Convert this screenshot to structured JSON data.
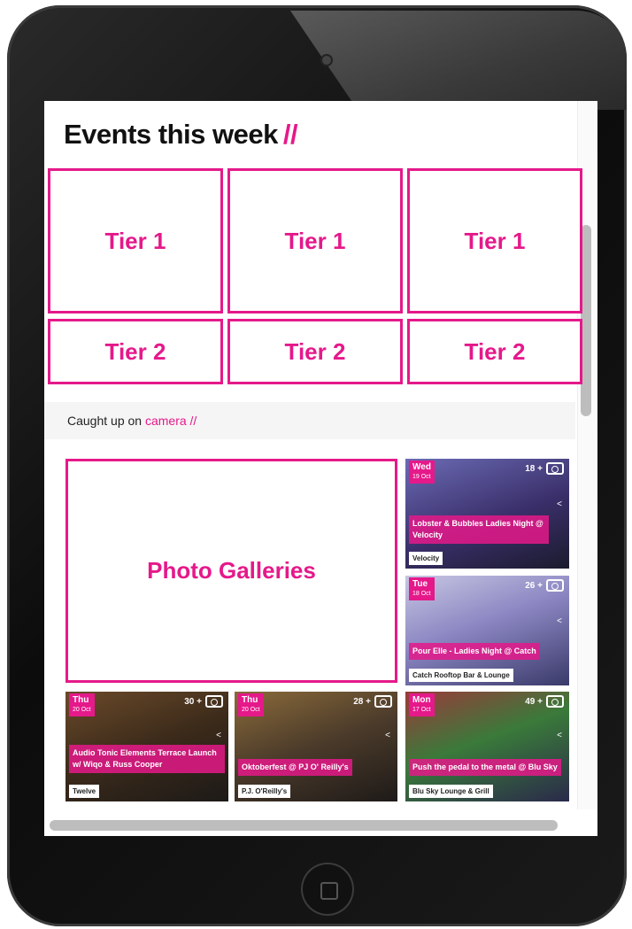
{
  "header": {
    "title": "Events this week",
    "title_suffix": "//"
  },
  "tiers": {
    "tier1": [
      "Tier 1",
      "Tier 1",
      "Tier 1"
    ],
    "tier2": [
      "Tier 2",
      "Tier 2",
      "Tier 2"
    ]
  },
  "caught": {
    "prefix": "Caught up on",
    "link": "camera",
    "suffix": "//"
  },
  "photo_galleries": {
    "label": "Photo Galleries"
  },
  "cards": [
    {
      "day": "Wed",
      "date": "19 Oct",
      "count": "18 +",
      "title": "Lobster & Bubbles Ladies Night @ Velocity",
      "venue": "Velocity",
      "bg": "linear-gradient(160deg,#6b6bb5 0%,#3a2f6a 55%,#1b1b2e 100%)"
    },
    {
      "day": "Tue",
      "date": "18 Oct",
      "count": "26 +",
      "title": "Pour Elle - Ladies Night @ Catch",
      "venue": "Catch Rooftop Bar & Lounge",
      "bg": "linear-gradient(160deg,#c7c7e3 0%,#8b86c2 45%,#3a3a6a 100%)"
    },
    {
      "day": "Thu",
      "date": "20 Oct",
      "count": "30 +",
      "title": "Audio Tonic Elements Terrace Launch w/ Wiqo & Russ Cooper",
      "venue": "Twelve",
      "bg": "linear-gradient(160deg,#6b4a2a 0%,#3b2a1a 50%,#1d1a18 100%)"
    },
    {
      "day": "Thu",
      "date": "20 Oct",
      "count": "28 +",
      "title": "Oktoberfest @ PJ O' Reilly's",
      "venue": "P.J. O'Reilly's",
      "bg": "linear-gradient(160deg,#8a6a3a 0%,#4a3a2a 50%,#1e1a18 100%)"
    },
    {
      "day": "Mon",
      "date": "17 Oct",
      "count": "49 +",
      "title": "Push the pedal to the metal @ Blu Sky",
      "venue": "Blu Sky Lounge & Grill",
      "bg": "linear-gradient(160deg,#9a3a3a 0%,#3a7a3a 45%,#2a2a4a 100%)"
    }
  ]
}
